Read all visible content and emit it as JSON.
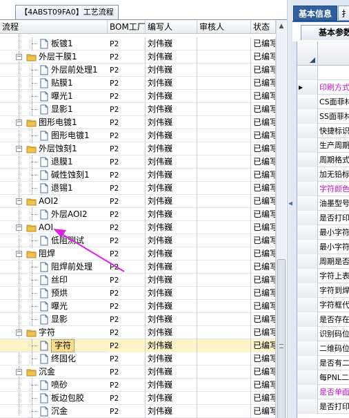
{
  "left_panel": {
    "title_tab": "【4ABST09FA0】工艺流程",
    "columns": [
      "流程",
      "BOM工厂",
      "编写人",
      "审核人",
      "状态"
    ],
    "rows": [
      {
        "label": "板镀1",
        "level": 2,
        "type": "doc",
        "factory": "P2",
        "author": "刘伟巍",
        "reviewer": "",
        "status": "已编写"
      },
      {
        "label": "外层干膜1",
        "level": 1,
        "type": "folder",
        "factory": "P2",
        "author": "刘伟巍",
        "reviewer": "",
        "status": "已编写"
      },
      {
        "label": "外层前处理1",
        "level": 2,
        "type": "doc",
        "factory": "P2",
        "author": "刘伟巍",
        "reviewer": "",
        "status": "已编写"
      },
      {
        "label": "贴膜1",
        "level": 2,
        "type": "doc",
        "factory": "P2",
        "author": "刘伟巍",
        "reviewer": "",
        "status": "已编写"
      },
      {
        "label": "曝光1",
        "level": 2,
        "type": "doc",
        "factory": "P2",
        "author": "刘伟巍",
        "reviewer": "",
        "status": "已编写"
      },
      {
        "label": "显影1",
        "level": 2,
        "type": "doc",
        "factory": "P2",
        "author": "刘伟巍",
        "reviewer": "",
        "status": "已编写"
      },
      {
        "label": "图形电镀1",
        "level": 1,
        "type": "folder",
        "factory": "P2",
        "author": "刘伟巍",
        "reviewer": "",
        "status": "已编写"
      },
      {
        "label": "图形电镀1",
        "level": 2,
        "type": "doc",
        "factory": "P2",
        "author": "刘伟巍",
        "reviewer": "",
        "status": "已编写"
      },
      {
        "label": "外层蚀刻1",
        "level": 1,
        "type": "folder",
        "factory": "P2",
        "author": "刘伟巍",
        "reviewer": "",
        "status": "已编写"
      },
      {
        "label": "退膜1",
        "level": 2,
        "type": "doc",
        "factory": "P2",
        "author": "刘伟巍",
        "reviewer": "",
        "status": "已编写"
      },
      {
        "label": "碱性蚀刻1",
        "level": 2,
        "type": "doc",
        "factory": "P2",
        "author": "刘伟巍",
        "reviewer": "",
        "status": "已编写"
      },
      {
        "label": "退锡1",
        "level": 2,
        "type": "doc",
        "factory": "P2",
        "author": "刘伟巍",
        "reviewer": "",
        "status": "已编写"
      },
      {
        "label": "AOI2",
        "level": 1,
        "type": "folder",
        "factory": "P2",
        "author": "刘伟巍",
        "reviewer": "",
        "status": "已编写"
      },
      {
        "label": "外层AOI2",
        "level": 2,
        "type": "doc",
        "factory": "P2",
        "author": "刘伟巍",
        "reviewer": "",
        "status": "已编写"
      },
      {
        "label": "AOI",
        "level": 1,
        "type": "folder",
        "factory": "P2",
        "author": "刘伟巍",
        "reviewer": "",
        "status": "已编写"
      },
      {
        "label": "低阻测试",
        "level": 2,
        "type": "doc",
        "factory": "P2",
        "author": "刘伟巍",
        "reviewer": "",
        "status": "已编写"
      },
      {
        "label": "阻焊",
        "level": 1,
        "type": "folder",
        "factory": "P2",
        "author": "刘伟巍",
        "reviewer": "",
        "status": "已编写"
      },
      {
        "label": "阻焊前处理",
        "level": 2,
        "type": "doc",
        "factory": "P2",
        "author": "刘伟巍",
        "reviewer": "",
        "status": "已编写"
      },
      {
        "label": "丝印",
        "level": 2,
        "type": "doc",
        "factory": "P2",
        "author": "刘伟巍",
        "reviewer": "",
        "status": "已编写"
      },
      {
        "label": "预烘",
        "level": 2,
        "type": "doc",
        "factory": "P2",
        "author": "刘伟巍",
        "reviewer": "",
        "status": "已编写"
      },
      {
        "label": "曝光",
        "level": 2,
        "type": "doc",
        "factory": "P2",
        "author": "刘伟巍",
        "reviewer": "",
        "status": "已编写"
      },
      {
        "label": "显影",
        "level": 2,
        "type": "doc",
        "factory": "P2",
        "author": "刘伟巍",
        "reviewer": "",
        "status": "已编写"
      },
      {
        "label": "字符",
        "level": 1,
        "type": "folder",
        "factory": "P2",
        "author": "刘伟巍",
        "reviewer": "",
        "status": "已编写"
      },
      {
        "label": "字符",
        "level": 2,
        "type": "doc",
        "factory": "P2",
        "author": "刘伟巍",
        "reviewer": "",
        "status": "已编写",
        "selected": true
      },
      {
        "label": "终固化",
        "level": 2,
        "type": "doc",
        "factory": "P2",
        "author": "刘伟巍",
        "reviewer": "",
        "status": "已编写"
      },
      {
        "label": "沉金",
        "level": 1,
        "type": "folder",
        "factory": "P2",
        "author": "刘伟巍",
        "reviewer": "",
        "status": "已编写"
      },
      {
        "label": "喷砂",
        "level": 2,
        "type": "doc",
        "factory": "P2",
        "author": "刘伟巍",
        "reviewer": "",
        "status": "已编写"
      },
      {
        "label": "板边包胶",
        "level": 2,
        "type": "doc",
        "factory": "P2",
        "author": "刘伟巍",
        "reviewer": "",
        "status": "已编写"
      },
      {
        "label": "沉金",
        "level": 2,
        "type": "doc",
        "factory": "P2",
        "author": "刘伟巍",
        "reviewer": "",
        "status": "已编写"
      }
    ]
  },
  "right_panel": {
    "tab_active": "基本信息",
    "tab_next": "扌",
    "sub_tab": "基本参数",
    "properties": [
      {
        "label": "",
        "pink": false
      },
      {
        "label": "印刷方式",
        "pink": true,
        "current": true
      },
      {
        "label": "CS面菲林",
        "pink": false
      },
      {
        "label": "SS面菲林",
        "pink": false
      },
      {
        "label": "快捷标识",
        "pink": false
      },
      {
        "label": "生产周期",
        "pink": false
      },
      {
        "label": "周期格式",
        "pink": false
      },
      {
        "label": "加无铅标",
        "pink": false
      },
      {
        "label": "字符颜色",
        "pink": true
      },
      {
        "label": "油墨型号",
        "pink": false
      },
      {
        "label": "是否打印",
        "pink": false
      },
      {
        "label": "最小字符",
        "pink": false
      },
      {
        "label": "最小字符",
        "pink": false
      },
      {
        "label": "周期是否",
        "pink": false
      },
      {
        "label": "字符上表",
        "pink": false
      },
      {
        "label": "字符到焊",
        "pink": false
      },
      {
        "label": "字符框代",
        "pink": false
      },
      {
        "label": "是否存在",
        "pink": false
      },
      {
        "label": "识别码位",
        "pink": false
      },
      {
        "label": "二维码位",
        "pink": false
      },
      {
        "label": "是否有二",
        "pink": false
      },
      {
        "label": "每PNL二维",
        "pink": false
      },
      {
        "label": "是否单面",
        "pink": true
      },
      {
        "label": "是否打印",
        "pink": false
      }
    ]
  },
  "colors": {
    "accent": "#2f5f9e",
    "selected_row": "#fff3c9",
    "arrow": "#e020e0",
    "pink_text": "#c013c0"
  }
}
